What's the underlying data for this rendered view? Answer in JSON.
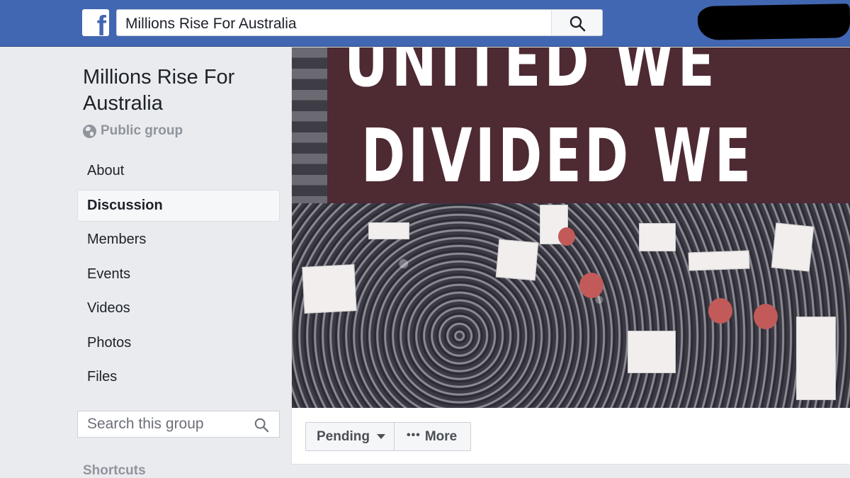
{
  "header": {
    "logo_letter": "f",
    "search_value": "Millions Rise For Australia"
  },
  "group": {
    "name": "Millions Rise For Australia",
    "privacy": "Public group"
  },
  "nav": {
    "items": [
      {
        "label": "About"
      },
      {
        "label": "Discussion",
        "active": true
      },
      {
        "label": "Members"
      },
      {
        "label": "Events"
      },
      {
        "label": "Videos"
      },
      {
        "label": "Photos"
      },
      {
        "label": "Files"
      }
    ]
  },
  "group_search": {
    "placeholder": "Search this group"
  },
  "shortcuts_label": "Shortcuts",
  "cover": {
    "line1": "UNITED WE",
    "line2": "DIVIDED WE"
  },
  "actions": {
    "pending_label": "Pending",
    "more_dots": "•••",
    "more_label": "More"
  },
  "colors": {
    "brand": "#4267b2",
    "banner": "#4e2a33"
  }
}
